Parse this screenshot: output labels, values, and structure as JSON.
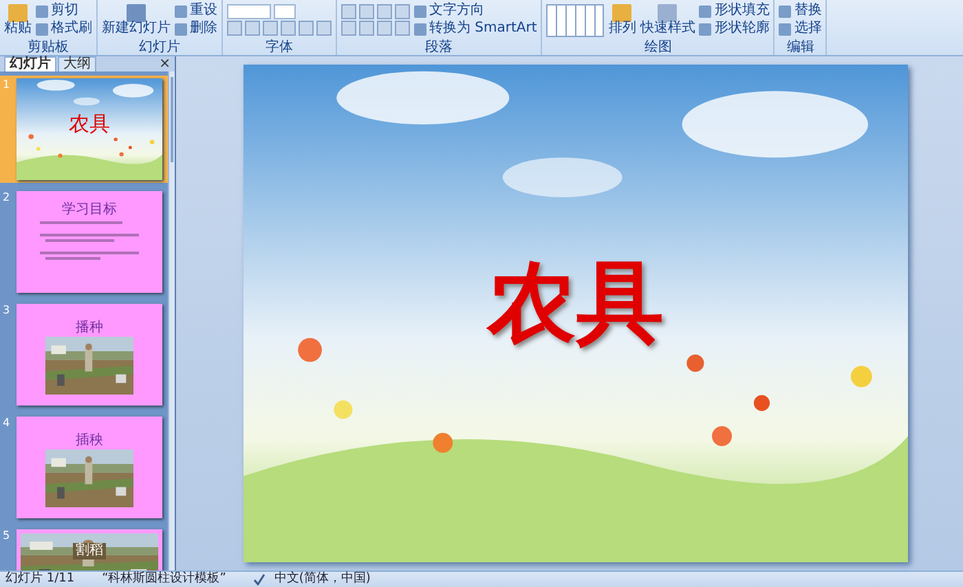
{
  "ribbon": {
    "groups": [
      {
        "label": "剪贴板",
        "large": "粘贴",
        "small": [
          "剪切",
          "格式刷"
        ]
      },
      {
        "label": "幻灯片",
        "large": "新建幻灯片",
        "small": [
          "重设",
          "删除"
        ]
      },
      {
        "label": "字体",
        "kind": "font"
      },
      {
        "label": "段落",
        "small": [
          "文字方向",
          "转换为 SmartArt"
        ],
        "kind": "paragraph"
      },
      {
        "label": "绘图",
        "large": "排列",
        "large2": "快速样式",
        "small": [
          "形状填充",
          "形状轮廓"
        ],
        "kind": "drawing"
      },
      {
        "label": "编辑",
        "small": [
          "替换",
          "选择"
        ]
      }
    ]
  },
  "pane": {
    "tabs": [
      {
        "label": "幻灯片",
        "selected": true
      },
      {
        "label": "大纲",
        "selected": false
      }
    ],
    "close": "×",
    "slides": [
      {
        "number": "1",
        "selected": true,
        "kind": "title",
        "title": "农具"
      },
      {
        "number": "2",
        "selected": false,
        "kind": "bullets",
        "title": "学习目标"
      },
      {
        "number": "3",
        "selected": false,
        "title": "播种"
      },
      {
        "number": "4",
        "selected": false,
        "title": "插秧"
      },
      {
        "number": "5",
        "selected": false,
        "kind": "banner",
        "title": "割稻"
      }
    ]
  },
  "slide": {
    "title": "农具"
  },
  "status_bar": {
    "slide": "幻灯片 1/11",
    "theme": "“科林斯圆柱设计模板”",
    "language": "中文(简体，中国)"
  }
}
